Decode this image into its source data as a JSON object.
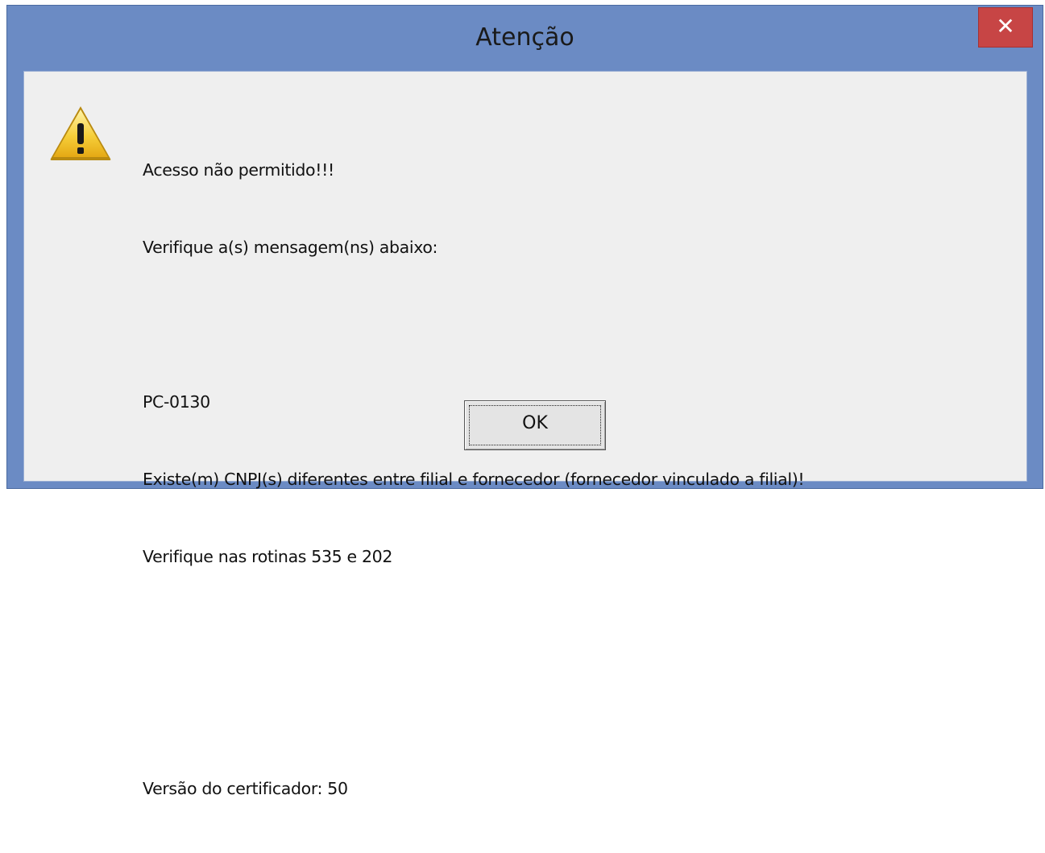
{
  "dialog": {
    "title": "Atenção",
    "close_glyph": "✕",
    "icon": "warning-icon",
    "message_lines": [
      "Acesso não permitido!!!",
      "Verifique a(s) mensagem(ns) abaixo:",
      "",
      "PC-0130",
      "Existe(m) CNPJ(s) diferentes entre filial e fornecedor (fornecedor vinculado a filial)!",
      "Verifique nas rotinas 535 e 202",
      "",
      "",
      "Versão do certificador: 50"
    ],
    "ok_label": "OK"
  },
  "colors": {
    "titlebar": "#6b8bc4",
    "close_button": "#c74545",
    "client_background": "#efefef"
  }
}
